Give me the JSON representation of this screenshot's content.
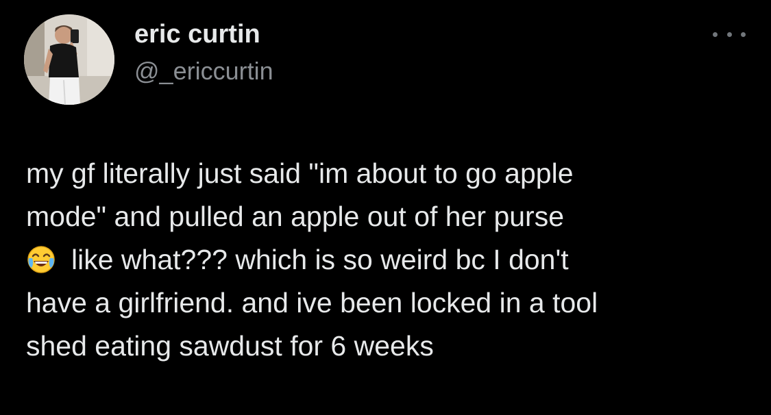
{
  "tweet": {
    "author": {
      "display_name": "eric curtin",
      "handle": "@_ericcurtin"
    },
    "text_lines": [
      "my gf literally just said \"im about to go apple",
      "mode\" and pulled an apple out of her purse",
      "like what??? which is so weird bc I don't",
      "have a girlfriend. and ive been locked in a tool",
      "shed eating sawdust for 6 weeks"
    ],
    "emoji": "tears-of-joy-emoji",
    "more_icon": "more-options-icon"
  },
  "colors": {
    "background": "#000000",
    "text_primary": "#e7e9ea",
    "text_secondary": "#8b8f94"
  }
}
